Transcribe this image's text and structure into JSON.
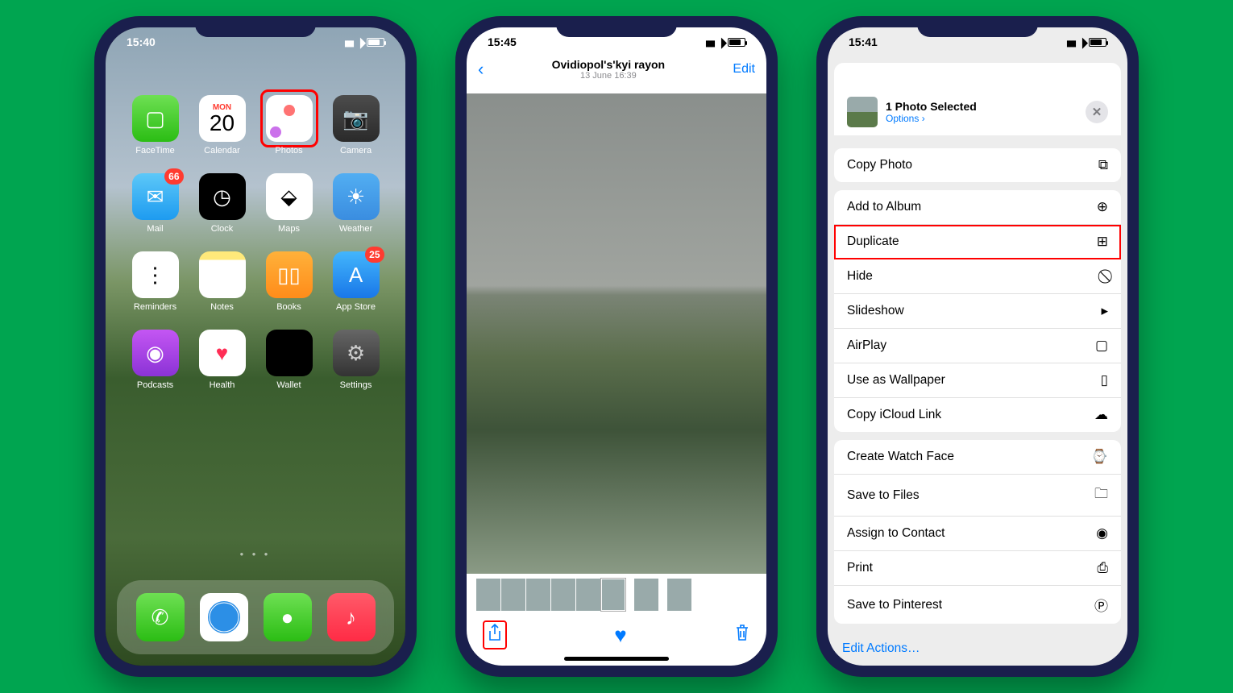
{
  "home": {
    "time": "15:40",
    "apps": [
      {
        "name": "FaceTime",
        "id": "facetime",
        "glyph": "▢"
      },
      {
        "name": "Calendar",
        "id": "calendar",
        "dow": "MON",
        "dnum": "20"
      },
      {
        "name": "Photos",
        "id": "photos",
        "highlight": true
      },
      {
        "name": "Camera",
        "id": "camera",
        "glyph": "📷"
      },
      {
        "name": "Mail",
        "id": "mail",
        "glyph": "✉",
        "badge": "66"
      },
      {
        "name": "Clock",
        "id": "clock",
        "glyph": "◷"
      },
      {
        "name": "Maps",
        "id": "maps",
        "glyph": "⬙"
      },
      {
        "name": "Weather",
        "id": "weather",
        "glyph": "☀"
      },
      {
        "name": "Reminders",
        "id": "reminders",
        "glyph": "⋮"
      },
      {
        "name": "Notes",
        "id": "notes",
        "glyph": ""
      },
      {
        "name": "Books",
        "id": "books",
        "glyph": "▯▯"
      },
      {
        "name": "App Store",
        "id": "appstore",
        "glyph": "A",
        "badge": "25"
      },
      {
        "name": "Podcasts",
        "id": "podcasts",
        "glyph": "◉"
      },
      {
        "name": "Health",
        "id": "health",
        "glyph": "♥"
      },
      {
        "name": "Wallet",
        "id": "wallet",
        "glyph": "—"
      },
      {
        "name": "Settings",
        "id": "settings",
        "glyph": "⚙"
      }
    ],
    "dock": [
      {
        "name": "Phone",
        "id": "phone",
        "glyph": "✆"
      },
      {
        "name": "Safari",
        "id": "safari",
        "glyph": "◎"
      },
      {
        "name": "Messages",
        "id": "messages",
        "glyph": "●"
      },
      {
        "name": "Music",
        "id": "music",
        "glyph": "♪"
      }
    ]
  },
  "detail": {
    "time": "15:45",
    "title": "Ovidiopol's'kyi rayon",
    "subtitle": "13 June  16:39",
    "edit": "Edit"
  },
  "share": {
    "time": "15:41",
    "title": "1 Photo Selected",
    "options_label": "Options",
    "groups": [
      [
        {
          "label": "Copy Photo",
          "icon": "⧉"
        }
      ],
      [
        {
          "label": "Add to Album",
          "icon": "⊕"
        },
        {
          "label": "Duplicate",
          "icon": "⊞",
          "highlight": true
        },
        {
          "label": "Hide",
          "icon": "⃠"
        },
        {
          "label": "Slideshow",
          "icon": "▸"
        },
        {
          "label": "AirPlay",
          "icon": "▢"
        },
        {
          "label": "Use as Wallpaper",
          "icon": "▯"
        },
        {
          "label": "Copy iCloud Link",
          "icon": "☁"
        }
      ],
      [
        {
          "label": "Create Watch Face",
          "icon": "⌚"
        },
        {
          "label": "Save to Files",
          "icon": "🗀"
        },
        {
          "label": "Assign to Contact",
          "icon": "◉"
        },
        {
          "label": "Print",
          "icon": "⎙"
        },
        {
          "label": "Save to Pinterest",
          "icon": "Ⓟ"
        }
      ]
    ],
    "edit_actions": "Edit Actions…"
  }
}
